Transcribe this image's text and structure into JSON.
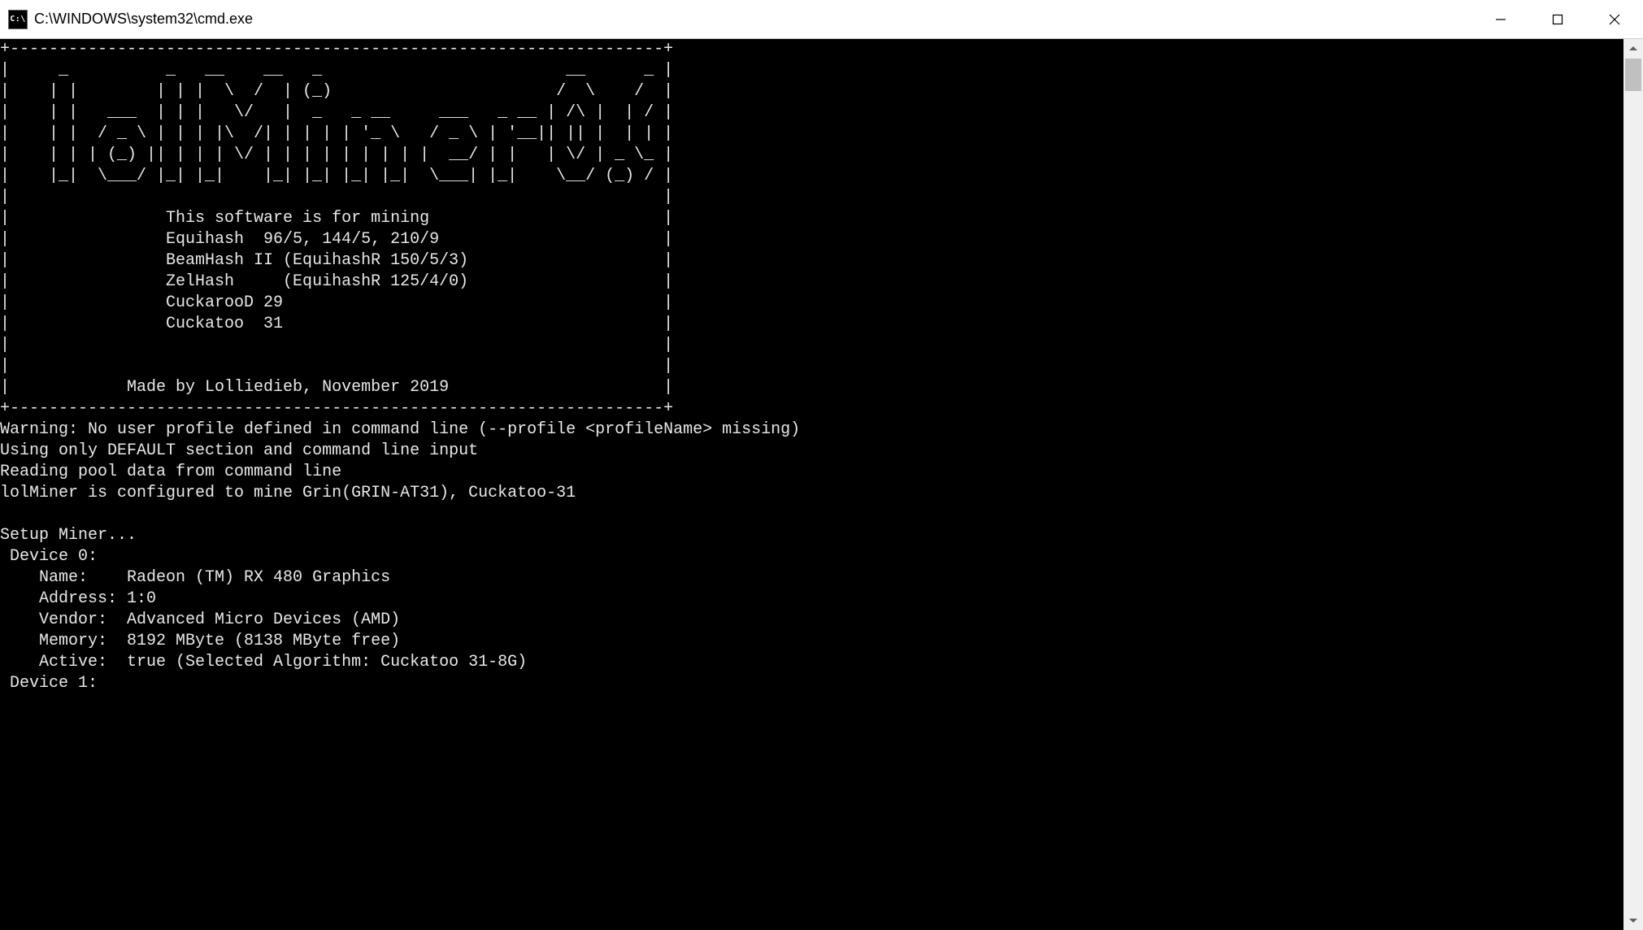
{
  "window": {
    "icon_label": "C:\\",
    "title": "C:\\WINDOWS\\system32\\cmd.exe"
  },
  "banner": {
    "border_top": "+-----------------------------------------------------------------+",
    "l00": "|    _          _   ____    ____   _                        ___      ___                |",
    "l01": "|   | |        | | |  _ \\  / _  | (_)                      /   \\    /   \\               |",
    "l02": "|   | |   ___  | | | | \\ \\/ / | |  _   _ __     ___   _ __ | | | |  | | | |              |",
    "l03": "|   | |  / _ \\ | | | |  \\  /  | | | | | '_ \\   / _ \\ | '__|| |_| |  | |_| |              |",
    "l04": "|   | | | (_) || | | |   \\/   | | | | | | | | |  __/ | |   |  _  | _|___  |              |",
    "l05": "|   |_|  \\___/ |_| |_|        |_| |_| |_| |_|  \\___| |_|    \\___/ (_)  /_/               |",
    "body": [
      "|                                                                 |",
      "|                This software is for mining                      |",
      "|                Equihash  96/5, 144/5, 210/9                     |",
      "|                BeamHash II (EquihashR 150/5/3)                  |",
      "|                ZelHash     (EquihashR 125/4/0)                  |",
      "|                CuckarooD 29                                     |",
      "|                Cuckatoo  31                                     |",
      "|                                                                 |",
      "|                                                                 |",
      "|            Made by Lolliedieb, November 2019                    |"
    ],
    "border_bot": "+-----------------------------------------------------------------+"
  },
  "messages": [
    "Warning: No user profile defined in command line (--profile <profileName> missing)",
    "Using only DEFAULT section and command line input",
    "Reading pool data from command line",
    "lolMiner is configured to mine Grin(GRIN-AT31), Cuckatoo-31",
    "",
    "Setup Miner...",
    " Device 0:",
    "    Name:    Radeon (TM) RX 480 Graphics",
    "    Address: 1:0",
    "    Vendor:  Advanced Micro Devices (AMD)",
    "    Memory:  8192 MByte (8138 MByte free)",
    "    Active:  true (Selected Algorithm: Cuckatoo 31-8G)",
    " Device 1:"
  ]
}
